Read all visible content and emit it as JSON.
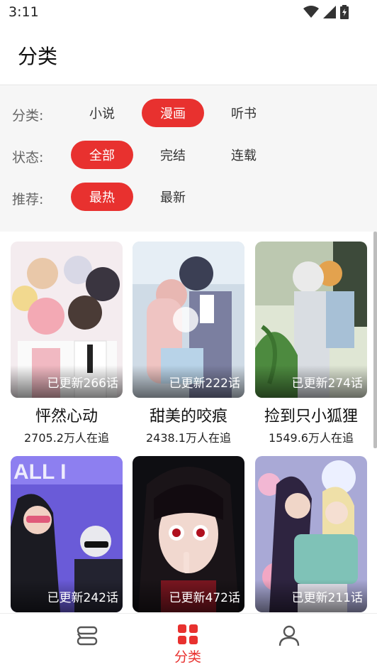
{
  "status_bar": {
    "time": "3:11"
  },
  "header": {
    "title": "分类"
  },
  "filters": {
    "category": {
      "label": "分类:",
      "options": [
        "小说",
        "漫画",
        "听书"
      ],
      "selected": "漫画"
    },
    "status": {
      "label": "状态:",
      "options": [
        "全部",
        "完结",
        "连载"
      ],
      "selected": "全部"
    },
    "recommend": {
      "label": "推荐:",
      "options": [
        "最热",
        "最新"
      ],
      "selected": "最热"
    }
  },
  "comics": [
    {
      "title": "怦然心动",
      "update": "已更新266话",
      "followers": "2705.2万人在追"
    },
    {
      "title": "甜美的咬痕",
      "update": "已更新222话",
      "followers": "2438.1万人在追"
    },
    {
      "title": "捡到只小狐狸",
      "update": "已更新274话",
      "followers": "1549.6万人在追"
    },
    {
      "title": "",
      "update": "已更新242话",
      "followers": ""
    },
    {
      "title": "",
      "update": "已更新472话",
      "followers": ""
    },
    {
      "title": "",
      "update": "已更新211话",
      "followers": ""
    }
  ],
  "bottom_nav": {
    "items": [
      {
        "icon": "bookshelf-icon",
        "label": ""
      },
      {
        "icon": "category-grid-icon",
        "label": "分类"
      },
      {
        "icon": "profile-icon",
        "label": ""
      }
    ],
    "active": "分类"
  },
  "colors": {
    "accent": "#e8312f",
    "filter_bg": "#f6f6f6"
  }
}
